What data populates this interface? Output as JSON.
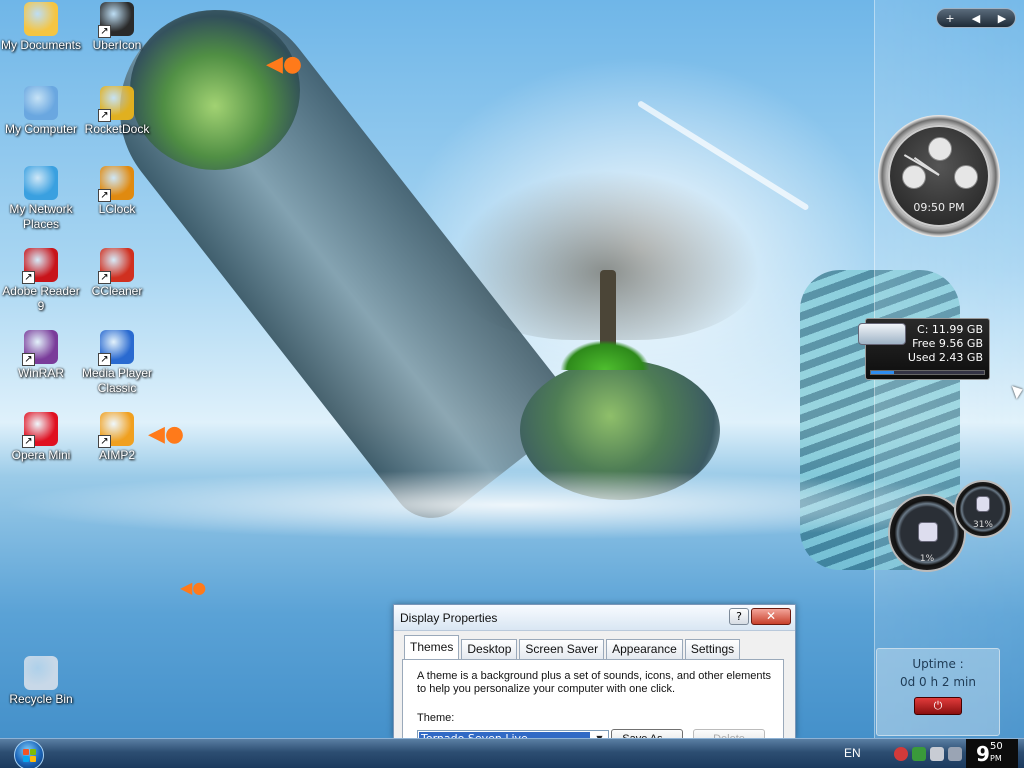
{
  "desktop_icons": [
    {
      "label": "My Documents",
      "icon": "folder-icon",
      "color": "#f5c542"
    },
    {
      "label": "UberIcon",
      "icon": "ubericon-icon",
      "color": "#2a2a2a"
    },
    {
      "label": "My Computer",
      "icon": "computer-icon",
      "color": "#6aa7e0"
    },
    {
      "label": "RocketDock",
      "icon": "rocketdock-icon",
      "color": "#e0b020"
    },
    {
      "label": "My Network Places",
      "icon": "network-globe-icon",
      "color": "#3aa0e0"
    },
    {
      "label": "LClock",
      "icon": "clock-icon",
      "color": "#e08a10"
    },
    {
      "label": "Adobe Reader 9",
      "icon": "adobe-reader-icon",
      "color": "#c8141a"
    },
    {
      "label": "CCleaner",
      "icon": "ccleaner-icon",
      "color": "#d03020"
    },
    {
      "label": "WinRAR",
      "icon": "winrar-icon",
      "color": "#7a3c9a"
    },
    {
      "label": "Media Player Classic",
      "icon": "media-player-icon",
      "color": "#2a6ad0"
    },
    {
      "label": "Opera Mini",
      "icon": "opera-icon",
      "color": "#e01020"
    },
    {
      "label": "AIMP2",
      "icon": "aimp-icon",
      "color": "#f0a020"
    },
    {
      "label": "Recycle Bin",
      "icon": "recycle-bin-icon",
      "color": "#c8d8e8"
    }
  ],
  "sidebar": {
    "controls": {
      "add": "+",
      "prev": "◀",
      "next": "▶"
    },
    "clock": {
      "time": "09:50 PM"
    },
    "drive": {
      "title": "C:  11.99 GB",
      "free": "Free 9.56 GB",
      "used": "Used 2.43 GB",
      "used_fraction": 0.2
    },
    "gauges": {
      "cpu": "1%",
      "memory": "31%"
    },
    "uptime": {
      "label": "Uptime :",
      "value": "0d 0 h 2 min",
      "power_icon": "power-icon"
    }
  },
  "window": {
    "title": "Display Properties",
    "help_label": "?",
    "close_label": "✕",
    "tabs": [
      "Themes",
      "Desktop",
      "Screen Saver",
      "Appearance",
      "Settings"
    ],
    "active_tab": 0,
    "description": "A theme is a background plus a set of sounds, icons, and other elements to help you personalize your computer with one click.",
    "theme_label": "Theme:",
    "theme_value": "Tornado Seven Live",
    "save_as_label": "Save As...",
    "delete_label": "Delete"
  },
  "taskbar": {
    "language": "EN",
    "clock_hour": "9",
    "clock_minutes": "50",
    "clock_ampm": "PM",
    "accent": "#1b3a5e"
  }
}
